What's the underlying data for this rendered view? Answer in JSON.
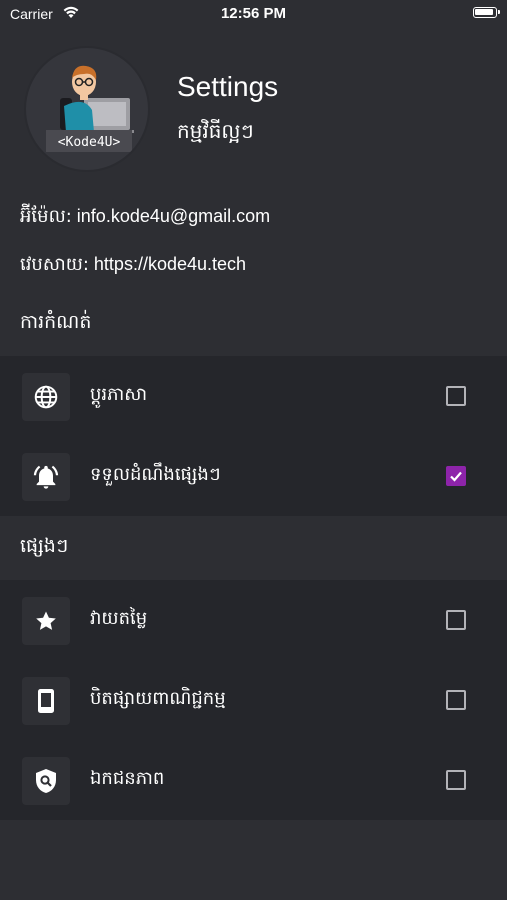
{
  "status_bar": {
    "carrier": "Carrier",
    "time": "12:56 PM"
  },
  "profile": {
    "avatar_badge": "<Kode4U>",
    "title": "Settings",
    "subtitle": "កម្មវិធីល្អៗ"
  },
  "info": {
    "email_label": "អ៊ីម៉ែល:",
    "email_value": "info.kode4u@gmail.com",
    "website_label": "វេបសាយ:",
    "website_value": "https://kode4u.tech"
  },
  "sections": [
    {
      "header": "ការកំណត់",
      "items": [
        {
          "label": "ប្ដូរភាសា",
          "icon": "globe-icon",
          "checked": false
        },
        {
          "label": "ទទួលដំណឹងផ្សេងៗ",
          "icon": "bell-icon",
          "checked": true
        }
      ]
    },
    {
      "header": "ផ្សេងៗ",
      "items": [
        {
          "label": "វាយតម្លៃ",
          "icon": "star-icon",
          "checked": false
        },
        {
          "label": "បិតផ្សាយពាណិជ្ជកម្ម",
          "icon": "phone-icon",
          "checked": false
        },
        {
          "label": "ឯកជនភាព",
          "icon": "privacy-shield-icon",
          "checked": false
        }
      ]
    }
  ],
  "colors": {
    "background": "#2d2e33",
    "section_bg": "#25262b",
    "accent": "#8e24aa"
  }
}
